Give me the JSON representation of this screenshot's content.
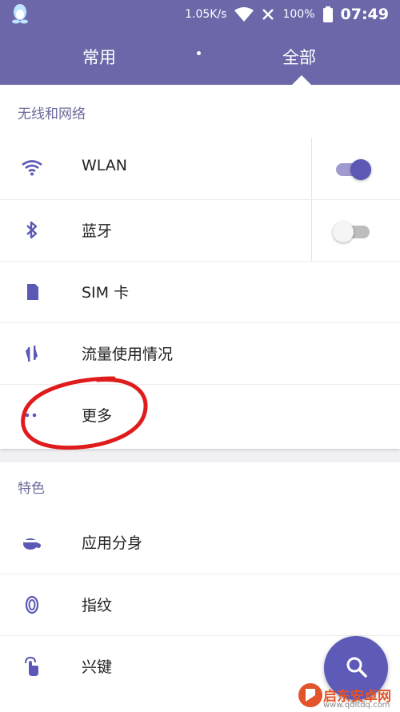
{
  "status_bar": {
    "speed": "1.05K/s",
    "battery": "100%",
    "time": "07:49"
  },
  "tabs": [
    {
      "label": "常用",
      "selected": false
    },
    {
      "label": "全部",
      "selected": true
    }
  ],
  "sections": {
    "network": {
      "title": "无线和网络",
      "items": [
        {
          "label": "WLAN",
          "icon": "wifi-icon",
          "switch": true
        },
        {
          "label": "蓝牙",
          "icon": "bluetooth-icon",
          "switch": false
        },
        {
          "label": "SIM 卡",
          "icon": "sim-card-icon"
        },
        {
          "label": "流量使用情况",
          "icon": "data-usage-icon"
        },
        {
          "label": "更多",
          "icon": "more-icon"
        }
      ]
    },
    "features": {
      "title": "特色",
      "items": [
        {
          "label": "应用分身",
          "icon": "app-clone-icon"
        },
        {
          "label": "指纹",
          "icon": "fingerprint-icon"
        },
        {
          "label": "兴键",
          "icon": "touch-key-icon"
        }
      ]
    }
  },
  "watermark": {
    "text": "启东安卓网",
    "url": "www.qdltdq.com"
  },
  "colors": {
    "header": "#6b67a8",
    "accent": "#5b58b6",
    "annotation": "#e01b1b"
  }
}
